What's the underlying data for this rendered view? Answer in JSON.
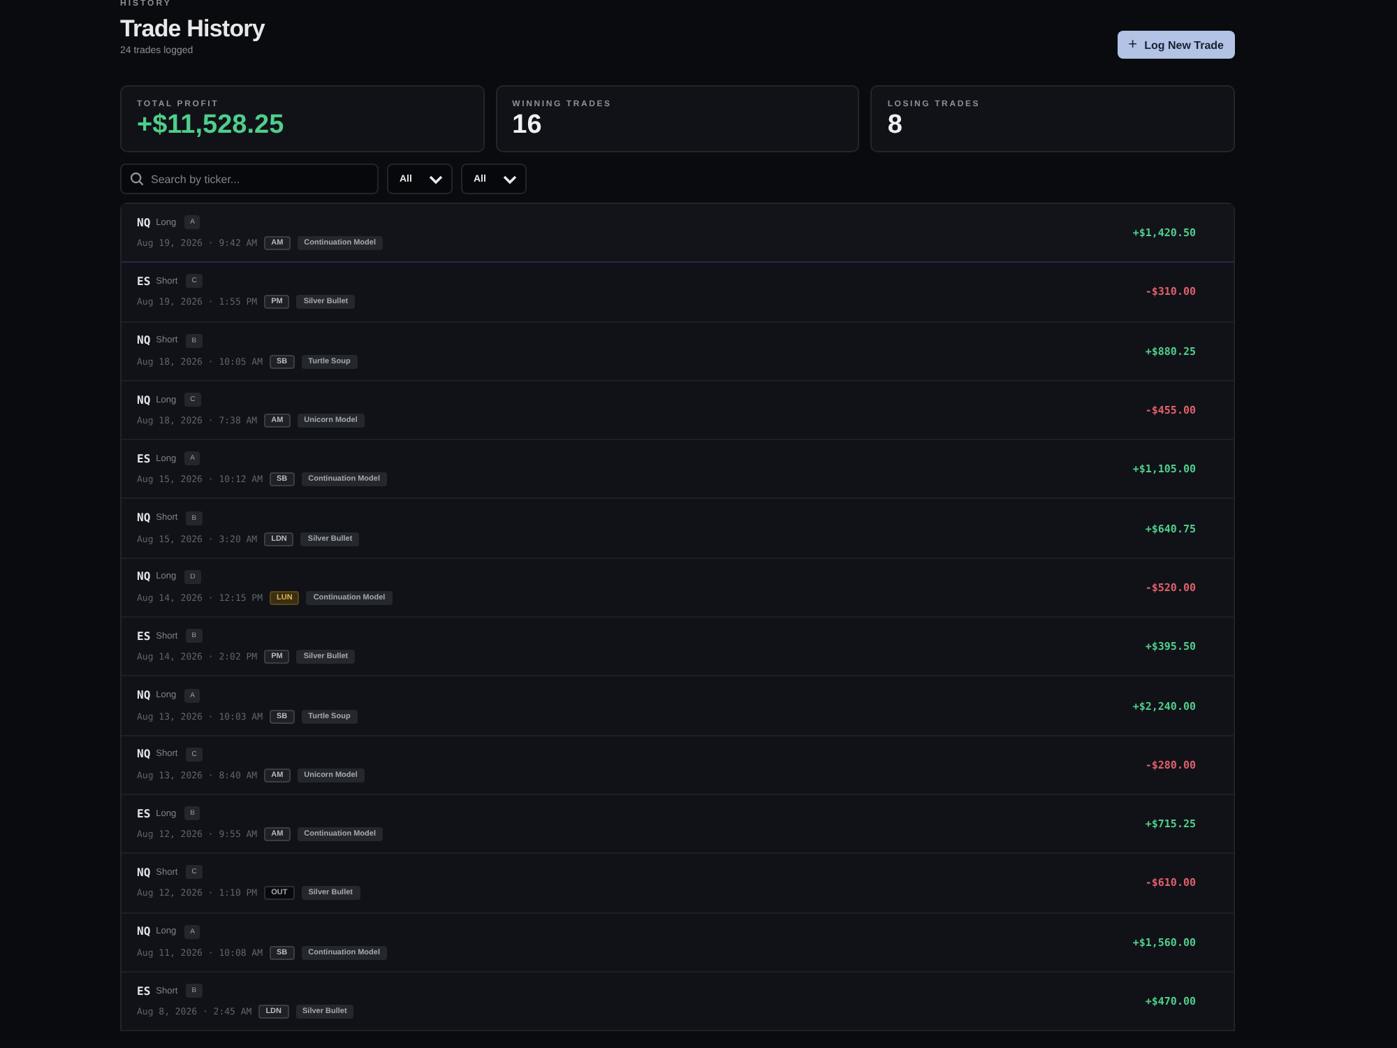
{
  "header": {
    "eyebrow": "HISTORY",
    "title": "Trade History",
    "subtitle": "24 trades logged",
    "button": {
      "icon": "+",
      "label": "Log New Trade"
    }
  },
  "stats": [
    {
      "label": "TOTAL PROFIT",
      "value": "+$11,528.25",
      "kind": "profit"
    },
    {
      "label": "WINNING TRADES",
      "value": "16",
      "kind": "plain"
    },
    {
      "label": "LOSING TRADES",
      "value": "8",
      "kind": "plain"
    }
  ],
  "filters": {
    "search": {
      "placeholder": "Search by ticker..."
    },
    "selects": [
      {
        "value": "All"
      },
      {
        "value": "All"
      }
    ]
  },
  "trades": [
    {
      "ticker": "NQ",
      "direction": "Long",
      "grade": "A",
      "datetime": "Aug 19, 2026 · 9:42 AM",
      "session": {
        "label": "AM",
        "kind": "normal"
      },
      "model": "Continuation Model",
      "pnl": "+$1,420.50",
      "win": true,
      "selected": true
    },
    {
      "ticker": "ES",
      "direction": "Short",
      "grade": "C",
      "datetime": "Aug 19, 2026 · 1:55 PM",
      "session": {
        "label": "PM",
        "kind": "normal"
      },
      "model": "Silver Bullet",
      "pnl": "-$310.00",
      "win": false,
      "selected": false
    },
    {
      "ticker": "NQ",
      "direction": "Short",
      "grade": "B",
      "datetime": "Aug 18, 2026 · 10:05 AM",
      "session": {
        "label": "SB",
        "kind": "normal"
      },
      "model": "Turtle Soup",
      "pnl": "+$880.25",
      "win": true,
      "selected": false
    },
    {
      "ticker": "NQ",
      "direction": "Long",
      "grade": "C",
      "datetime": "Aug 18, 2026 · 7:38 AM",
      "session": {
        "label": "AM",
        "kind": "normal"
      },
      "model": "Unicorn Model",
      "pnl": "-$455.00",
      "win": false,
      "selected": false
    },
    {
      "ticker": "ES",
      "direction": "Long",
      "grade": "A",
      "datetime": "Aug 15, 2026 · 10:12 AM",
      "session": {
        "label": "SB",
        "kind": "normal"
      },
      "model": "Continuation Model",
      "pnl": "+$1,105.00",
      "win": true,
      "selected": false
    },
    {
      "ticker": "NQ",
      "direction": "Short",
      "grade": "B",
      "datetime": "Aug 15, 2026 · 3:20 AM",
      "session": {
        "label": "LDN",
        "kind": "normal"
      },
      "model": "Silver Bullet",
      "pnl": "+$640.75",
      "win": true,
      "selected": false
    },
    {
      "ticker": "NQ",
      "direction": "Long",
      "grade": "D",
      "datetime": "Aug 14, 2026 · 12:15 PM",
      "session": {
        "label": "LUN",
        "kind": "lunch"
      },
      "model": "Continuation Model",
      "pnl": "-$520.00",
      "win": false,
      "selected": false
    },
    {
      "ticker": "ES",
      "direction": "Short",
      "grade": "B",
      "datetime": "Aug 14, 2026 · 2:02 PM",
      "session": {
        "label": "PM",
        "kind": "normal"
      },
      "model": "Silver Bullet",
      "pnl": "+$395.50",
      "win": true,
      "selected": false
    },
    {
      "ticker": "NQ",
      "direction": "Long",
      "grade": "A",
      "datetime": "Aug 13, 2026 · 10:03 AM",
      "session": {
        "label": "SB",
        "kind": "normal"
      },
      "model": "Turtle Soup",
      "pnl": "+$2,240.00",
      "win": true,
      "selected": false
    },
    {
      "ticker": "NQ",
      "direction": "Short",
      "grade": "C",
      "datetime": "Aug 13, 2026 · 8:40 AM",
      "session": {
        "label": "AM",
        "kind": "normal"
      },
      "model": "Unicorn Model",
      "pnl": "-$280.00",
      "win": false,
      "selected": false
    },
    {
      "ticker": "ES",
      "direction": "Long",
      "grade": "B",
      "datetime": "Aug 12, 2026 · 9:55 AM",
      "session": {
        "label": "AM",
        "kind": "normal"
      },
      "model": "Continuation Model",
      "pnl": "+$715.25",
      "win": true,
      "selected": false
    },
    {
      "ticker": "NQ",
      "direction": "Short",
      "grade": "C",
      "datetime": "Aug 12, 2026 · 1:10 PM",
      "session": {
        "label": "OUT",
        "kind": "out"
      },
      "model": "Silver Bullet",
      "pnl": "-$610.00",
      "win": false,
      "selected": false
    },
    {
      "ticker": "NQ",
      "direction": "Long",
      "grade": "A",
      "datetime": "Aug 11, 2026 · 10:08 AM",
      "session": {
        "label": "SB",
        "kind": "normal"
      },
      "model": "Continuation Model",
      "pnl": "+$1,560.00",
      "win": true,
      "selected": false
    },
    {
      "ticker": "ES",
      "direction": "Short",
      "grade": "B",
      "datetime": "Aug 8, 2026 · 2:45 AM",
      "session": {
        "label": "LDN",
        "kind": "normal"
      },
      "model": "Silver Bullet",
      "pnl": "+$470.00",
      "win": true,
      "selected": false
    }
  ]
}
